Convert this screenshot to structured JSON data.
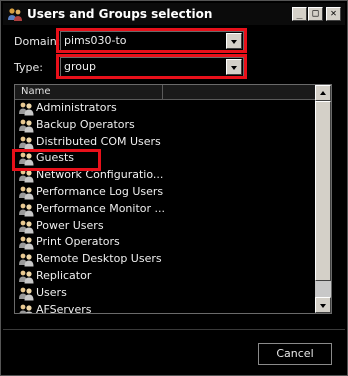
{
  "window": {
    "title": "Users and Groups selection",
    "buttons": {
      "minimize": "_",
      "maximize": "□",
      "close": "✕"
    }
  },
  "form": {
    "domain_label": "Domain:",
    "domain_value": "pims030-to",
    "type_label": "Type:",
    "type_value": "group"
  },
  "list": {
    "columns": [
      "Name",
      ""
    ],
    "items": [
      {
        "name": "Administrators"
      },
      {
        "name": "Backup Operators"
      },
      {
        "name": "Distributed COM Users"
      },
      {
        "name": "Guests"
      },
      {
        "name": "Network Configuratio..."
      },
      {
        "name": "Performance Log Users"
      },
      {
        "name": "Performance Monitor ..."
      },
      {
        "name": "Power Users"
      },
      {
        "name": "Print Operators"
      },
      {
        "name": "Remote Desktop Users"
      },
      {
        "name": "Replicator"
      },
      {
        "name": "Users"
      },
      {
        "name": "AFServers"
      }
    ]
  },
  "footer": {
    "cancel_label": "Cancel"
  },
  "colors": {
    "highlight": "#e8101a",
    "background": "#000000"
  },
  "icons": {
    "app": "users-app-icon",
    "group": "user-group-icon"
  }
}
